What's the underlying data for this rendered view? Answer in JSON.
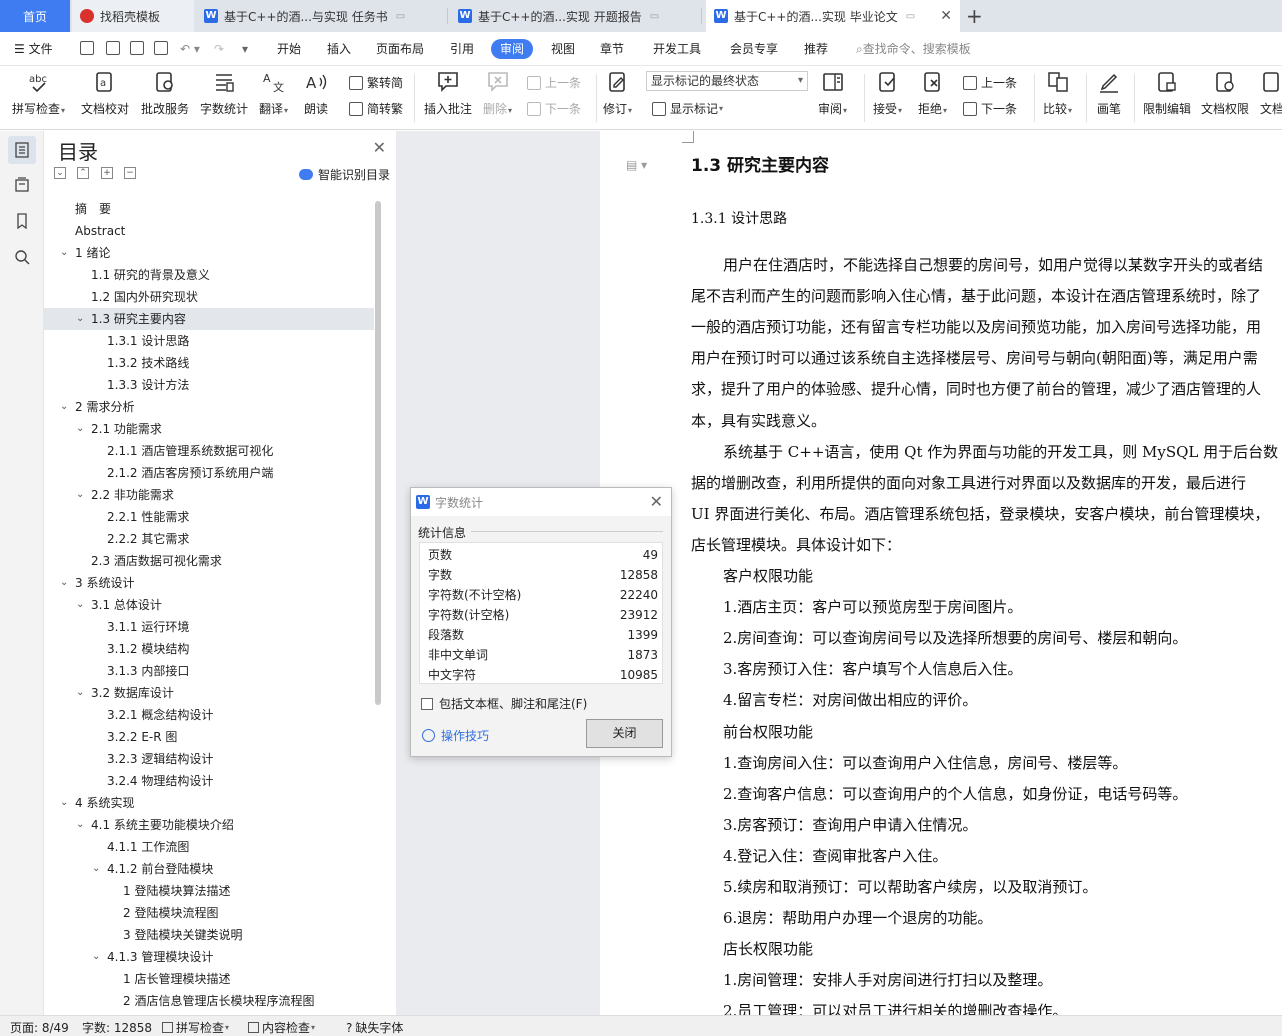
{
  "tabs": [
    {
      "label": "首页"
    },
    {
      "label": "找稻壳模板"
    },
    {
      "label": "基于C++的酒...与实现 任务书"
    },
    {
      "label": "基于C++的酒...实现 开题报告"
    },
    {
      "label": "基于C++的酒...实现 毕业论文"
    }
  ],
  "menu": {
    "file": "文件",
    "items": [
      "开始",
      "插入",
      "页面布局",
      "引用",
      "审阅",
      "视图",
      "章节",
      "开发工具",
      "会员专享",
      "推荐"
    ],
    "search": "查找命令、搜索模板"
  },
  "ribbon": {
    "spell": "拼写检查",
    "proof": "文档校对",
    "batch": "批改服务",
    "wordcount": "字数统计",
    "translate": "翻译",
    "read": "朗读",
    "t2s": "繁转简",
    "s2t": "简转繁",
    "comment": "插入批注",
    "delete": "删除",
    "prev": "上一条",
    "next": "下一条",
    "revise": "修订",
    "markup_mode": "显示标记的最终状态",
    "show_markup": "显示标记",
    "review": "审阅",
    "accept": "接受",
    "reject": "拒绝",
    "prev2": "上一条",
    "next2": "下一条",
    "compare": "比较",
    "pen": "画笔",
    "restrict": "限制编辑",
    "perm": "文档权限",
    "doc": "文档"
  },
  "toc": {
    "title": "目录",
    "smart": "智能识别目录",
    "items": [
      {
        "text": "摘　要",
        "level": 0,
        "arrow": ""
      },
      {
        "text": "Abstract",
        "level": 0,
        "arrow": ""
      },
      {
        "text": "1 绪论",
        "level": 0,
        "arrow": "v"
      },
      {
        "text": "1.1 研究的背景及意义",
        "level": 1,
        "arrow": ""
      },
      {
        "text": "1.2 国内外研究现状",
        "level": 1,
        "arrow": ""
      },
      {
        "text": "1.3 研究主要内容",
        "level": 1,
        "arrow": "v",
        "selected": true
      },
      {
        "text": "1.3.1 设计思路",
        "level": 2,
        "arrow": ""
      },
      {
        "text": "1.3.2 技术路线",
        "level": 2,
        "arrow": ""
      },
      {
        "text": "1.3.3 设计方法",
        "level": 2,
        "arrow": ""
      },
      {
        "text": "2 需求分析",
        "level": 0,
        "arrow": "v"
      },
      {
        "text": "2.1 功能需求",
        "level": 1,
        "arrow": "v"
      },
      {
        "text": "2.1.1 酒店管理系统数据可视化",
        "level": 2,
        "arrow": ""
      },
      {
        "text": "2.1.2 酒店客房预订系统用户端",
        "level": 2,
        "arrow": ""
      },
      {
        "text": "2.2 非功能需求",
        "level": 1,
        "arrow": "v"
      },
      {
        "text": "2.2.1 性能需求",
        "level": 2,
        "arrow": ""
      },
      {
        "text": "2.2.2 其它需求",
        "level": 2,
        "arrow": ""
      },
      {
        "text": "2.3 酒店数据可视化需求",
        "level": 1,
        "arrow": ""
      },
      {
        "text": "3 系统设计",
        "level": 0,
        "arrow": "v"
      },
      {
        "text": "3.1 总体设计",
        "level": 1,
        "arrow": "v"
      },
      {
        "text": "3.1.1 运行环境",
        "level": 2,
        "arrow": ""
      },
      {
        "text": "3.1.2 模块结构",
        "level": 2,
        "arrow": ""
      },
      {
        "text": "3.1.3 内部接口",
        "level": 2,
        "arrow": ""
      },
      {
        "text": "3.2 数据库设计",
        "level": 1,
        "arrow": "v"
      },
      {
        "text": "3.2.1 概念结构设计",
        "level": 2,
        "arrow": ""
      },
      {
        "text": "3.2.2 E-R 图",
        "level": 2,
        "arrow": ""
      },
      {
        "text": "3.2.3 逻辑结构设计",
        "level": 2,
        "arrow": ""
      },
      {
        "text": "3.2.4 物理结构设计",
        "level": 2,
        "arrow": ""
      },
      {
        "text": "4 系统实现",
        "level": 0,
        "arrow": "v"
      },
      {
        "text": "4.1 系统主要功能模块介绍",
        "level": 1,
        "arrow": "v"
      },
      {
        "text": "4.1.1 工作流图",
        "level": 2,
        "arrow": ""
      },
      {
        "text": "4.1.2 前台登陆模块",
        "level": 2,
        "arrow": "v"
      },
      {
        "text": "1 登陆模块算法描述",
        "level": 3,
        "arrow": ""
      },
      {
        "text": "2 登陆模块流程图",
        "level": 3,
        "arrow": ""
      },
      {
        "text": "3 登陆模块关键类说明",
        "level": 3,
        "arrow": ""
      },
      {
        "text": "4.1.3 管理模块设计",
        "level": 2,
        "arrow": "v"
      },
      {
        "text": "1 店长管理模块描述",
        "level": 3,
        "arrow": ""
      },
      {
        "text": "2 酒店信息管理店长模块程序流程图",
        "level": 3,
        "arrow": ""
      }
    ]
  },
  "doc": {
    "lines": [
      {
        "t": "1.3 研究主要内容",
        "cls": "h2"
      },
      {
        "t": "1.3.1 设计思路",
        "cls": "h3"
      },
      {
        "t": "用户在住酒店时，不能选择自己想要的房间号，如用户觉得以某数字开头的或者结",
        "cls": "ind"
      },
      {
        "t": "尾不吉利而产生的问题而影响入住心情，基于此问题，本设计在酒店管理系统时，除了",
        "cls": ""
      },
      {
        "t": "一般的酒店预订功能，还有留言专栏功能以及房间预览功能，加入房间号选择功能，用",
        "cls": ""
      },
      {
        "t": "用户在预订时可以通过该系统自主选择楼层号、房间号与朝向(朝阳面)等，满足用户需",
        "cls": ""
      },
      {
        "t": "求，提升了用户的体验感、提升心情，同时也方便了前台的管理，减少了酒店管理的人",
        "cls": ""
      },
      {
        "t": "本，具有实践意义。",
        "cls": ""
      },
      {
        "t": "系统基于 C++语言，使用 Qt 作为界面与功能的开发工具，则 MySQL 用于后台数",
        "cls": "ind"
      },
      {
        "t": "据的增删改查，利用所提供的面向对象工具进行对界面以及数据库的开发，最后进行",
        "cls": ""
      },
      {
        "t": "UI 界面进行美化、布局。酒店管理系统包括，登录模块，安客户模块，前台管理模块，",
        "cls": ""
      },
      {
        "t": "店长管理模块。具体设计如下：",
        "cls": ""
      },
      {
        "t": "客户权限功能",
        "cls": "ind"
      },
      {
        "t": "1.酒店主页：客户可以预览房型于房间图片。",
        "cls": "ind"
      },
      {
        "t": "2.房间查询：可以查询房间号以及选择所想要的房间号、楼层和朝向。",
        "cls": "ind"
      },
      {
        "t": "3.客房预订入住：客户填写个人信息后入住。",
        "cls": "ind"
      },
      {
        "t": "4.留言专栏：对房间做出相应的评价。",
        "cls": "ind"
      },
      {
        "t": "前台权限功能",
        "cls": "ind"
      },
      {
        "t": "1.查询房间入住：可以查询用户入住信息，房间号、楼层等。",
        "cls": "ind"
      },
      {
        "t": "2.查询客户信息：可以查询用户的个人信息，如身份证，电话号码等。",
        "cls": "ind"
      },
      {
        "t": "3.房客预订：查询用户申请入住情况。",
        "cls": "ind"
      },
      {
        "t": "4.登记入住：查阅审批客户入住。",
        "cls": "ind"
      },
      {
        "t": "5.续房和取消预订：可以帮助客户续房，以及取消预订。",
        "cls": "ind"
      },
      {
        "t": "6.退房：帮助用户办理一个退房的功能。",
        "cls": "ind"
      },
      {
        "t": "店长权限功能",
        "cls": "ind"
      },
      {
        "t": "1.房间管理：安排人手对房间进行打扫以及整理。",
        "cls": "ind"
      },
      {
        "t": "2.员工管理：可以对员工进行相关的增删改查操作。",
        "cls": "ind"
      }
    ]
  },
  "dialog": {
    "title": "字数统计",
    "group": "统计信息",
    "rows": [
      {
        "k": "页数",
        "v": "49"
      },
      {
        "k": "字数",
        "v": "12858"
      },
      {
        "k": "字符数(不计空格)",
        "v": "22240"
      },
      {
        "k": "字符数(计空格)",
        "v": "23912"
      },
      {
        "k": "段落数",
        "v": "1399"
      },
      {
        "k": "非中文单词",
        "v": "1873"
      },
      {
        "k": "中文字符",
        "v": "10985"
      }
    ],
    "checkbox": "包括文本框、脚注和尾注(F)",
    "tips": "操作技巧",
    "close": "关闭"
  },
  "status": {
    "page": "页面: 8/49",
    "words": "字数: 12858",
    "spell": "拼写检查",
    "content": "内容检查",
    "font": "缺失字体"
  }
}
